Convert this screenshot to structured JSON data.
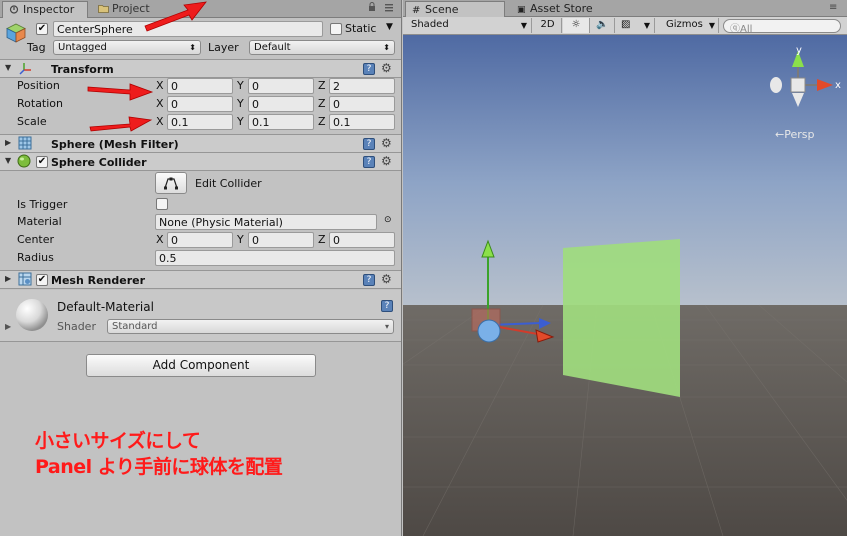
{
  "inspector": {
    "tab_inspector": "Inspector",
    "tab_project": "Project",
    "object_name": "CenterSphere",
    "static_label": "Static",
    "tag_label": "Tag",
    "tag_value": "Untagged",
    "layer_label": "Layer",
    "layer_value": "Default",
    "transform": {
      "title": "Transform",
      "position_label": "Position",
      "rotation_label": "Rotation",
      "scale_label": "Scale",
      "position": {
        "x": "0",
        "y": "0",
        "z": "2"
      },
      "rotation": {
        "x": "0",
        "y": "0",
        "z": "0"
      },
      "scale": {
        "x": "0.1",
        "y": "0.1",
        "z": "0.1"
      }
    },
    "axis_x": "X",
    "axis_y": "Y",
    "axis_z": "Z",
    "mesh_filter_title": "Sphere (Mesh Filter)",
    "sphere_collider": {
      "title": "Sphere Collider",
      "edit_button": "Edit Collider",
      "is_trigger_label": "Is Trigger",
      "material_label": "Material",
      "material_value": "None (Physic Material)",
      "center_label": "Center",
      "center": {
        "x": "0",
        "y": "0",
        "z": "0"
      },
      "radius_label": "Radius",
      "radius_value": "0.5"
    },
    "mesh_renderer_title": "Mesh Renderer",
    "material": {
      "name": "Default-Material",
      "shader_label": "Shader",
      "shader_value": "Standard"
    },
    "add_component": "Add Component",
    "annotation_line1": "小さいサイズにして",
    "annotation_line2": "Panel より手前に球体を配置"
  },
  "scene": {
    "tab_scene": "Scene",
    "tab_asset_store": "Asset Store",
    "shading_mode": "Shaded",
    "mode_2d": "2D",
    "gizmos_label": "Gizmos",
    "search_placeholder": "All",
    "persp_label": "Persp",
    "orient_y_label": "y",
    "orient_x_label": "x"
  },
  "colors": {
    "arrow_red": "#ee1c1c",
    "annotation_red": "#ff1a1a",
    "panel_green": "#9fdc7e",
    "sky_top": "#4f6aa3",
    "ground": "#57524d"
  }
}
